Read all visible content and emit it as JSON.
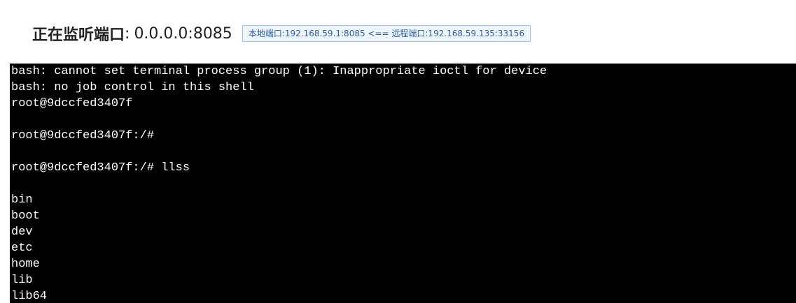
{
  "header": {
    "title_label": "正在监听端口",
    "separator": ":",
    "address": "0.0.0.0:8085",
    "connection_badge": "本地端口:192.168.59.1:8085 <== 远程端口:192.168.59.135:33156"
  },
  "terminal": {
    "lines": [
      "bash: cannot set terminal process group (1): Inappropriate ioctl for device",
      "bash: no job control in this shell",
      "root@9dccfed3407f",
      "",
      "root@9dccfed3407f:/#",
      "",
      "root@9dccfed3407f:/# llss",
      "",
      "bin",
      "boot",
      "dev",
      "etc",
      "home",
      "lib",
      "lib64"
    ],
    "background": "#000000",
    "foreground": "#ffffff"
  }
}
